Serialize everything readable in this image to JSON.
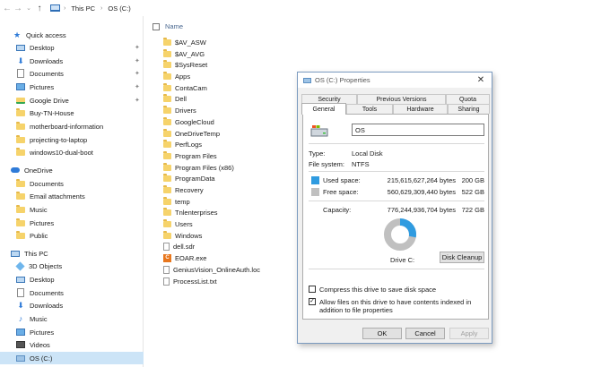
{
  "address": {
    "crumbs": [
      "This PC",
      "OS (C:)"
    ]
  },
  "nav": {
    "quick_access": "Quick access",
    "quick_items": [
      "Desktop",
      "Downloads",
      "Documents",
      "Pictures",
      "Google Drive",
      "Buy-TN-House",
      "motherboard-information",
      "projecting-to-laptop",
      "windows10-dual-boot"
    ],
    "onedrive": "OneDrive",
    "onedrive_items": [
      "Documents",
      "Email attachments",
      "Music",
      "Pictures",
      "Public"
    ],
    "this_pc": "This PC",
    "pc_items": [
      "3D Objects",
      "Desktop",
      "Documents",
      "Downloads",
      "Music",
      "Pictures",
      "Videos",
      "OS (C:)"
    ]
  },
  "files": {
    "header": "Name",
    "items": [
      "$AV_ASW",
      "$AV_AVG",
      "$SysReset",
      "Apps",
      "ContaCam",
      "Dell",
      "Drivers",
      "GoogleCloud",
      "OneDriveTemp",
      "PerfLogs",
      "Program Files",
      "Program Files (x86)",
      "ProgramData",
      "Recovery",
      "temp",
      "Tnlenterprises",
      "Users",
      "Windows",
      "dell.sdr",
      "EOAR.exe",
      "GeniusVision_OnlineAuth.loc",
      "ProcessList.txt"
    ]
  },
  "dialog": {
    "title": "OS (C:) Properties",
    "tabs_top": [
      "Security",
      "Previous Versions",
      "Quota"
    ],
    "tabs_bottom": [
      "General",
      "Tools",
      "Hardware",
      "Sharing"
    ],
    "name_value": "OS",
    "type_label": "Type:",
    "type_value": "Local Disk",
    "fs_label": "File system:",
    "fs_value": "NTFS",
    "used_label": "Used space:",
    "used_bytes": "215,615,627,264 bytes",
    "used_gb": "200 GB",
    "free_label": "Free space:",
    "free_bytes": "560,629,309,440 bytes",
    "free_gb": "522 GB",
    "cap_label": "Capacity:",
    "cap_bytes": "776,244,936,704 bytes",
    "cap_gb": "722 GB",
    "drive_label": "Drive C:",
    "cleanup_button": "Disk Cleanup",
    "compress_label": "Compress this drive to save disk space",
    "index_label": "Allow files on this drive to have contents indexed in addition to file properties",
    "ok": "OK",
    "cancel": "Cancel",
    "apply": "Apply",
    "used_fraction": 0.278,
    "colors": {
      "used": "#2f9be0",
      "free": "#c0c0c0"
    }
  }
}
